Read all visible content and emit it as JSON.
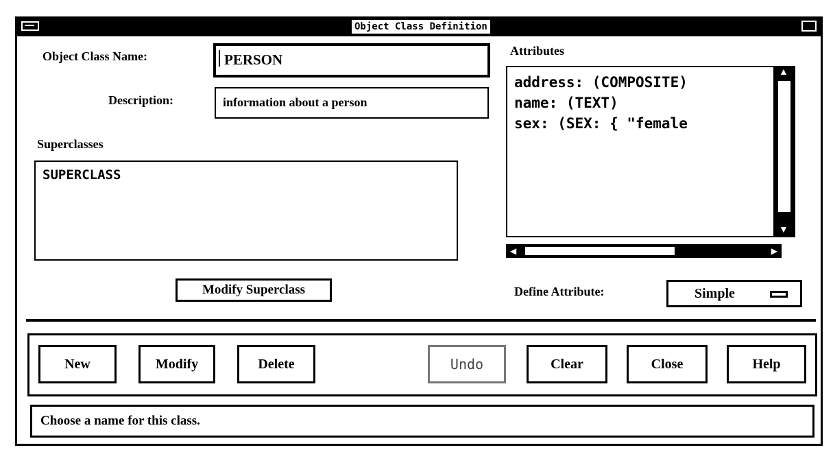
{
  "window": {
    "title": "Object Class Definition"
  },
  "form": {
    "class_name_label": "Object Class Name:",
    "class_name_value": "PERSON",
    "description_label": "Description:",
    "description_value": "information about a person",
    "superclasses_label": "Superclasses",
    "superclasses": [
      "SUPERCLASS"
    ],
    "modify_superclass_label": "Modify Superclass"
  },
  "attributes": {
    "label": "Attributes",
    "items": [
      "address: (COMPOSITE)",
      "name: (TEXT)",
      "sex: (SEX: { \"female"
    ],
    "define_label": "Define Attribute:",
    "define_value": "Simple"
  },
  "buttons": {
    "new": "New",
    "modify": "Modify",
    "delete": "Delete",
    "undo": "Undo",
    "clear": "Clear",
    "close": "Close",
    "help": "Help"
  },
  "status": {
    "message": "Choose a name for this class."
  }
}
